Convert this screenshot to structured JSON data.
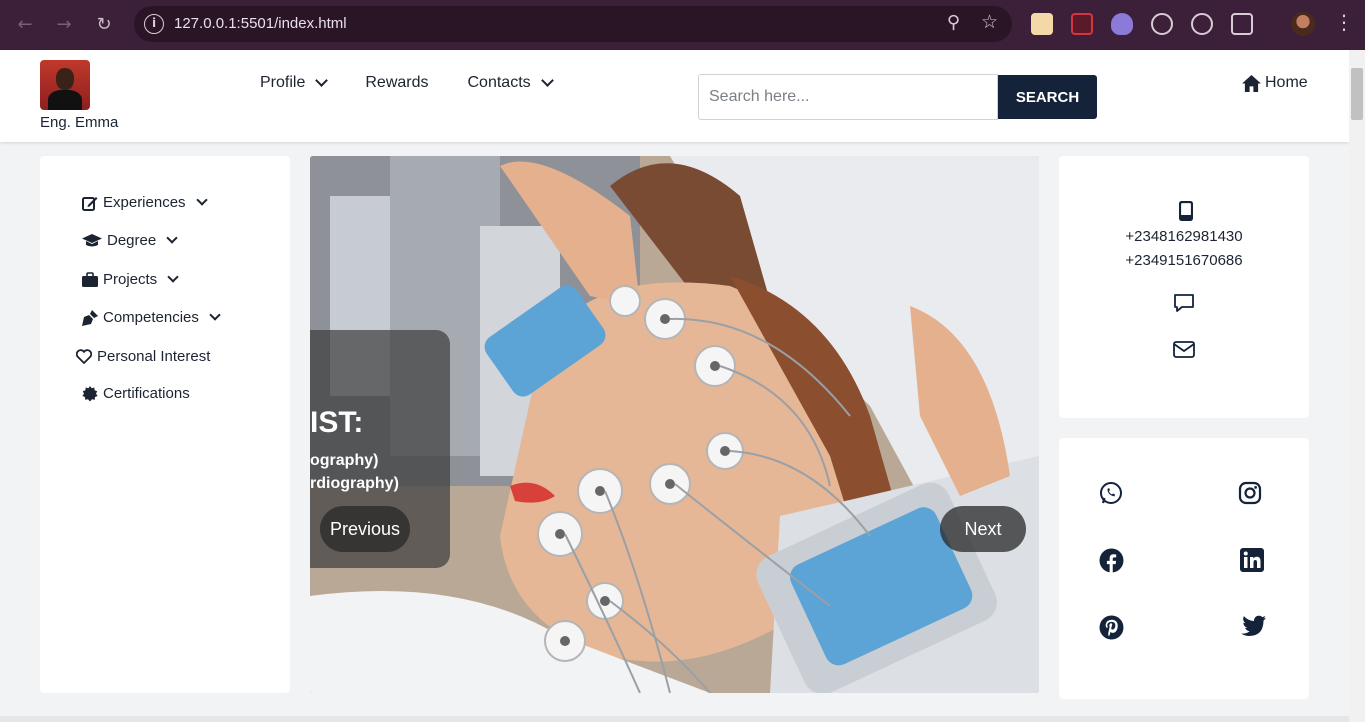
{
  "browser": {
    "url": "127.0.0.1:5501/index.html"
  },
  "header": {
    "brand_name": "Eng. Emma",
    "nav": [
      {
        "label": "Profile",
        "has_dropdown": true
      },
      {
        "label": "Rewards",
        "has_dropdown": false
      },
      {
        "label": "Contacts",
        "has_dropdown": true
      }
    ],
    "search": {
      "placeholder": "Search here...",
      "button_label": "SEARCH"
    },
    "home_label": "Home"
  },
  "sidebar": {
    "items": [
      {
        "label": "Experiences",
        "icon": "edit-icon",
        "has_dropdown": true
      },
      {
        "label": "Degree",
        "icon": "graduation-cap-icon",
        "has_dropdown": true
      },
      {
        "label": "Projects",
        "icon": "briefcase-icon",
        "has_dropdown": true
      },
      {
        "label": "Competencies",
        "icon": "pen-nib-icon",
        "has_dropdown": true
      },
      {
        "label": "Personal Interest",
        "icon": "heart-icon",
        "has_dropdown": false
      },
      {
        "label": "Certifications",
        "icon": "certificate-icon",
        "has_dropdown": false
      }
    ]
  },
  "carousel": {
    "caption_title": "IST:",
    "caption_lines": [
      "ography)",
      "rdiography)"
    ],
    "prev_label": "Previous",
    "next_label": "Next"
  },
  "contact": {
    "phones": [
      "+2348162981430",
      "+2349151670686"
    ],
    "icons": [
      "mobile-icon",
      "message-icon",
      "envelope-icon"
    ]
  },
  "social": {
    "icons": [
      "whatsapp-icon",
      "instagram-icon",
      "facebook-icon",
      "linkedin-icon",
      "pinterest-icon",
      "twitter-icon"
    ]
  },
  "colors": {
    "chrome_bg": "#3c1f38",
    "navy": "#14223a",
    "text": "#1c2431",
    "page_bg": "#f1f3f4"
  }
}
